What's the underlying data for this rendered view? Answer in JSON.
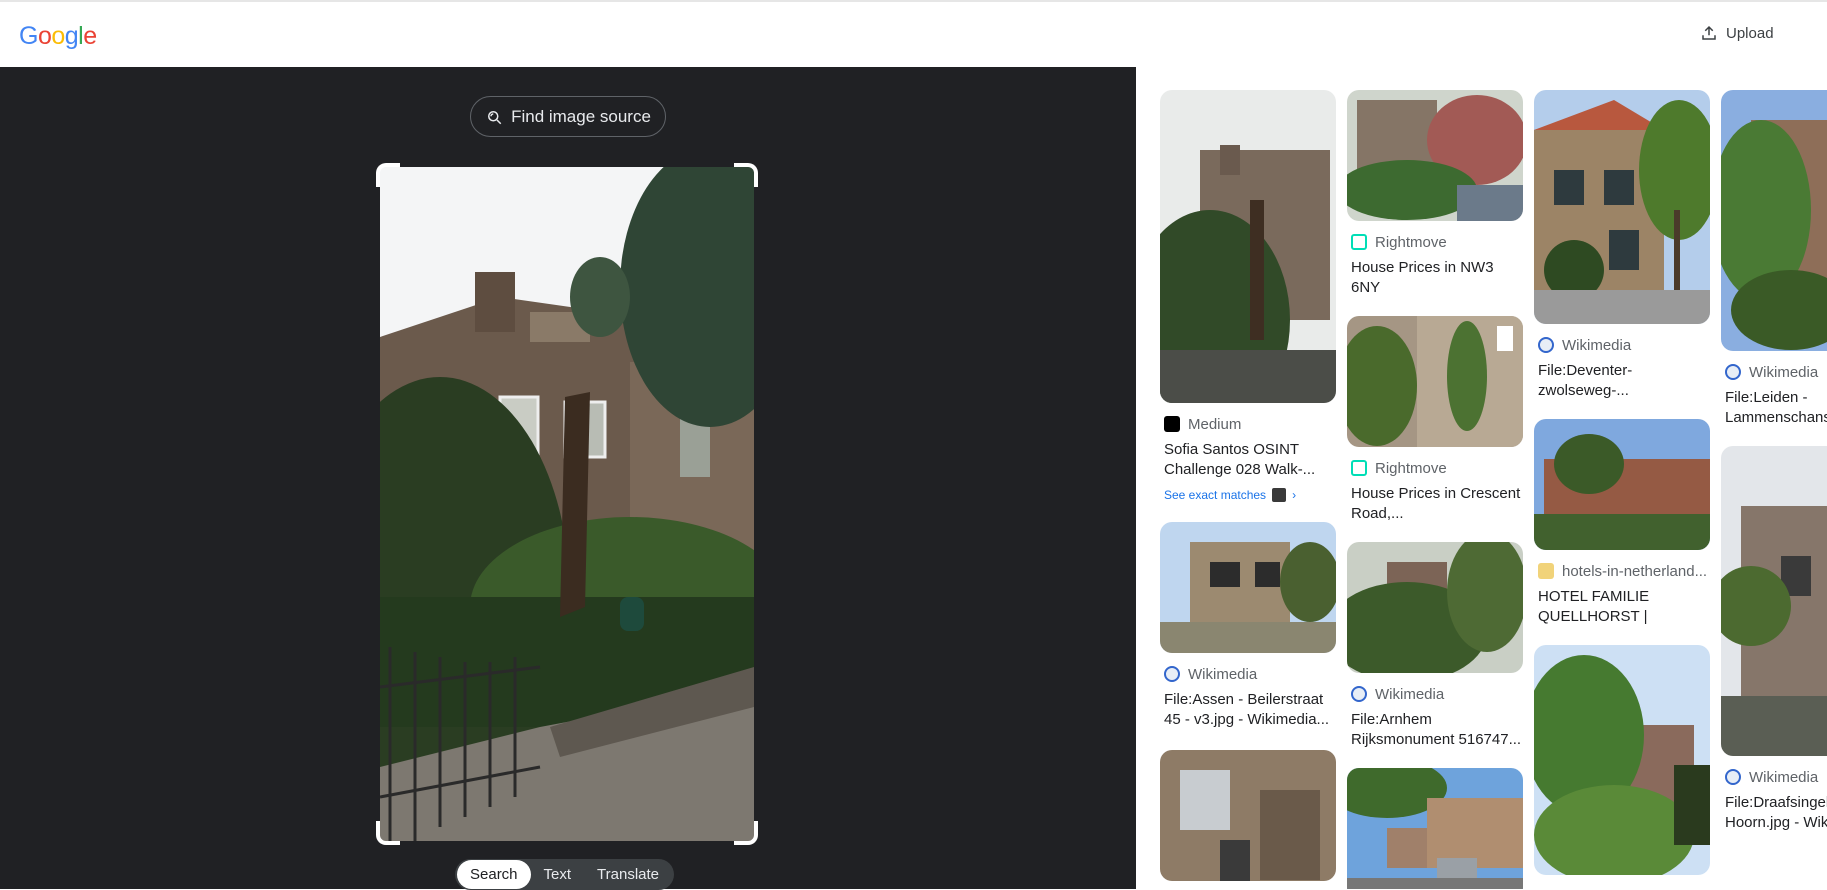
{
  "header": {
    "logo_letters": [
      {
        "ch": "G",
        "color": "#4285F4"
      },
      {
        "ch": "o",
        "color": "#EA4335"
      },
      {
        "ch": "o",
        "color": "#FBBC05"
      },
      {
        "ch": "g",
        "color": "#4285F4"
      },
      {
        "ch": "l",
        "color": "#34A853"
      },
      {
        "ch": "e",
        "color": "#EA4335"
      }
    ],
    "upload_label": "Upload",
    "upload_icon": "upload-icon"
  },
  "left_panel": {
    "find_source_label": "Find image source",
    "find_source_icon": "lens-search-icon",
    "modes": [
      "Search",
      "Text",
      "Translate"
    ],
    "active_mode": "Search"
  },
  "results": {
    "col1": [
      {
        "source": "Medium",
        "favicon": "medium-icon",
        "title": "Sofia Santos OSINT Challenge 028 Walk-...",
        "exact": "See exact matches"
      },
      {
        "source": "Wikimedia",
        "favicon": "wikimedia-icon",
        "title": "File:Assen - Beilerstraat 45 - v3.jpg - Wikimedia..."
      }
    ],
    "col2": [
      {
        "source": "Rightmove",
        "favicon": "rightmove-icon",
        "title": "House Prices in NW3 6NY"
      },
      {
        "source": "Rightmove",
        "favicon": "rightmove-icon",
        "title": "House Prices in Crescent Road,..."
      },
      {
        "source": "Wikimedia",
        "favicon": "wikimedia-icon",
        "title": "File:Arnhem Rijksmonument 516747..."
      }
    ],
    "col3": [
      {
        "source": "Wikimedia",
        "favicon": "wikimedia-icon",
        "title": "File:Deventer-zwolseweg-..."
      },
      {
        "source": "hotels-in-netherland...",
        "favicon": "hotel-icon",
        "title": "HOTEL FAMILIE QUELLHORST | LEIDEN,..."
      }
    ],
    "col4": [
      {
        "source": "Wikimedia",
        "favicon": "wikimedia-icon",
        "title": "File:Leiden - Lammenschans"
      },
      {
        "source": "Wikimedia",
        "favicon": "wikimedia-icon",
        "title": "File:Draafsingel Hoorn.jpg - Wik"
      }
    ]
  },
  "colors": {
    "dark_bg": "#202124",
    "link_blue": "#1a73e8",
    "rightmove_teal": "#00deb6"
  }
}
